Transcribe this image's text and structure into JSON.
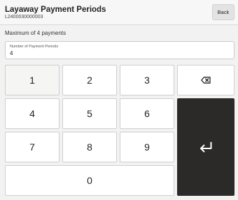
{
  "header": {
    "title": "Layaway Payment Periods",
    "subtitle": "L2400030000003",
    "back_label": "Back"
  },
  "info_text": "Maximum of 4 payments",
  "input": {
    "label": "Number of Payment Periods",
    "value": "4"
  },
  "keypad": {
    "k1": "1",
    "k2": "2",
    "k3": "3",
    "k4": "4",
    "k5": "5",
    "k6": "6",
    "k7": "7",
    "k8": "8",
    "k9": "9",
    "k0": "0",
    "backspace_icon": "backspace-icon",
    "enter_icon": "enter-return-icon"
  },
  "colors": {
    "enter_key_bg": "#2b2a28",
    "background": "#f2f2f2"
  }
}
